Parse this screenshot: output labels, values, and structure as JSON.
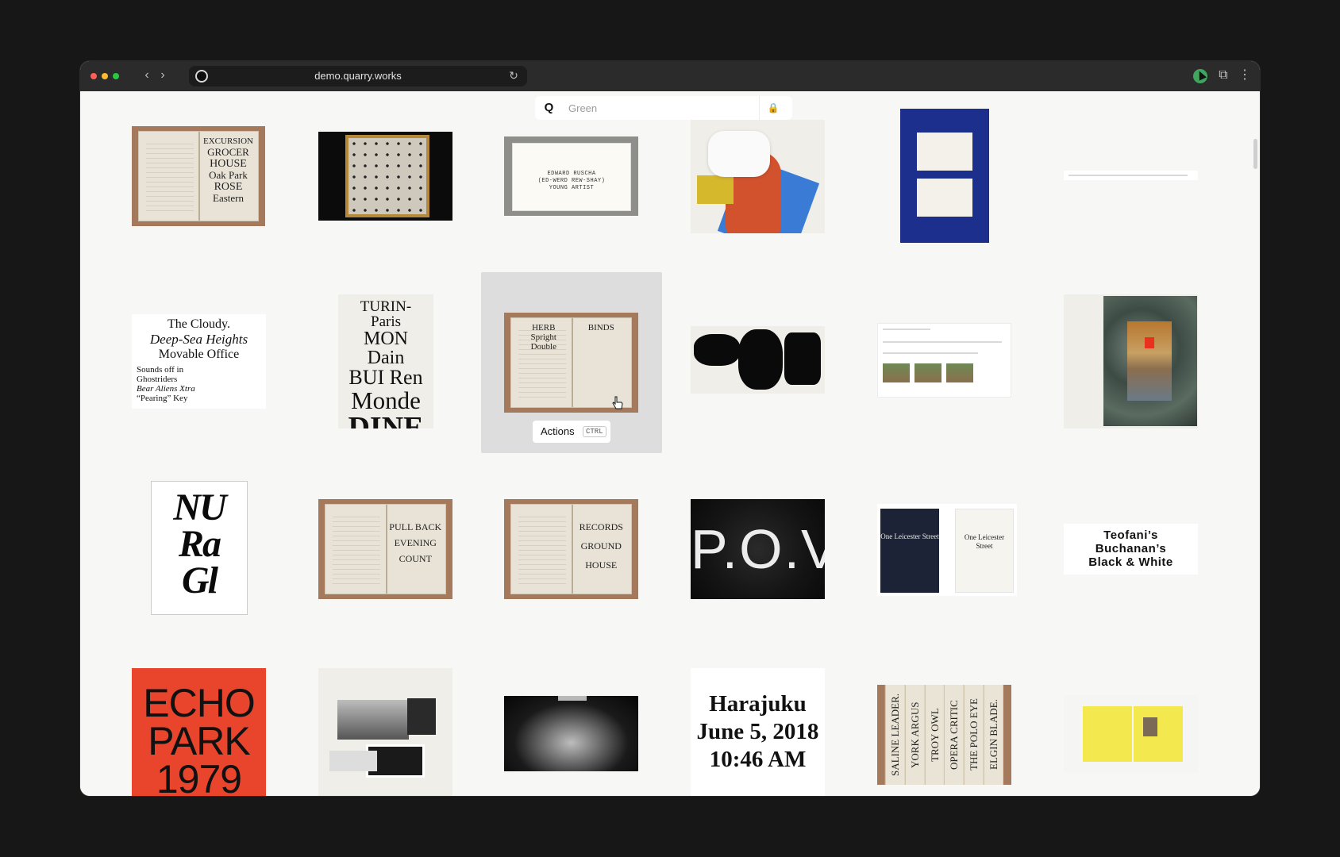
{
  "browser": {
    "url": "demo.quarry.works",
    "back_icon": "chevron-left-icon",
    "forward_icon": "chevron-right-icon",
    "reload_icon": "reload-icon",
    "extension_icon": "puzzle-icon",
    "menu_icon": "kebab-menu-icon"
  },
  "search": {
    "logo": "Q",
    "placeholder": "Green",
    "action_icon": "lock-icon"
  },
  "hover_actions": {
    "label": "Actions",
    "shortcut": "CTRL"
  },
  "tiles": {
    "book1": [
      "EXCURSION",
      "GROCER",
      "HOUSE",
      "Oak Park",
      "ROSE",
      "Eastern"
    ],
    "card": [
      "EDWARD RUSCHA",
      "(ED-WERD  REW-SHAY)",
      "YOUNG ARTIST"
    ],
    "cloudy": [
      "The Cloudy.",
      "Deep-Sea Heights",
      "Movable Office"
    ],
    "cloudy_sub": [
      "Sounds off in",
      "Ghostriders",
      "Bear Aliens Xtra",
      "“Pearing” Key"
    ],
    "turin": [
      "TURIN-Paris",
      "MON Dain",
      "BUI Ren",
      "Monde",
      "DINE"
    ],
    "book_hover": [
      "HERB",
      "Spright",
      "Double",
      "BINDS"
    ],
    "nura": [
      "NU",
      "Ra",
      "Gl"
    ],
    "book2": [
      "PULL BACK",
      "EVENING",
      "COUNT"
    ],
    "book3": [
      "RECORDS",
      "GROUND",
      "HOUSE"
    ],
    "pov": "P.O.V.",
    "leicester": "One Leicester Street",
    "teofani": [
      "Teofani’s",
      "Buchanan’s",
      "Black & White"
    ],
    "echo": [
      "ECHO",
      "PARK",
      "1979"
    ],
    "harajuku": [
      "Harajuku",
      "June 5, 2018",
      "10:46 AM"
    ],
    "spines": [
      "SALINE LEADER.",
      "YORK ARGUS",
      "TROY OWL",
      "OPERA CRITIC",
      "THE POLO EYE",
      "ELGIN BLADE."
    ]
  }
}
